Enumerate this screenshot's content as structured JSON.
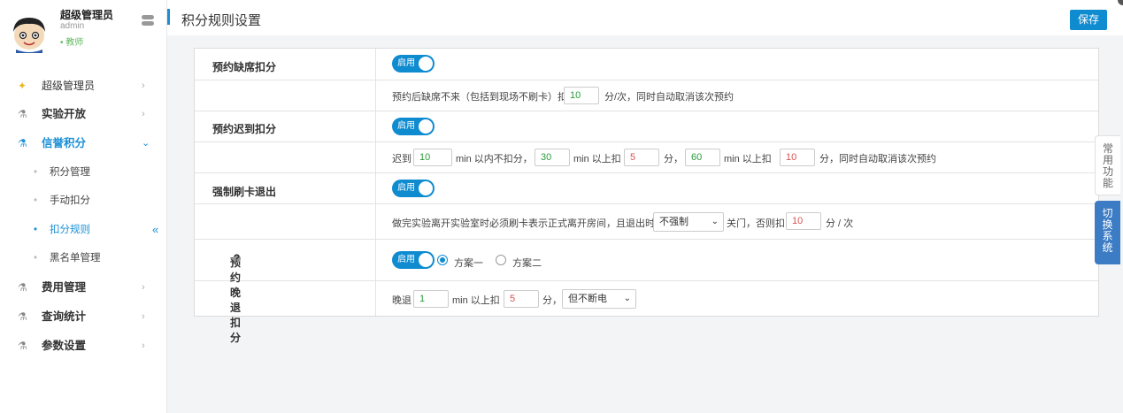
{
  "profile": {
    "name": "超级管理员",
    "account": "admin",
    "role": "• 教师"
  },
  "sidebar": {
    "items": [
      {
        "label": "超级管理员",
        "chevron": "›"
      },
      {
        "label": "实验开放",
        "chevron": "›"
      },
      {
        "label": "信誉积分",
        "chevron": "⌄"
      },
      {
        "label": "费用管理",
        "chevron": "›"
      },
      {
        "label": "查询统计",
        "chevron": "›"
      },
      {
        "label": "参数设置",
        "chevron": "›"
      }
    ],
    "sub_items": [
      {
        "label": "积分管理"
      },
      {
        "label": "手动扣分"
      },
      {
        "label": "扣分规则"
      },
      {
        "label": "黑名单管理"
      }
    ],
    "collapse_glyph": "«"
  },
  "header": {
    "title": "积分规则设置",
    "save_label": "保存"
  },
  "switch_label": "启用",
  "rules": {
    "absence": {
      "label": "预约缺席扣分",
      "text_a": "预约后缺席不来（包括到现场不刷卡）扣",
      "points": "10",
      "text_b": "分/次，同时自动取消该次预约"
    },
    "late": {
      "label": "预约迟到扣分",
      "t1": "迟到",
      "v1": "10",
      "t2": "min 以内不扣分，",
      "v2": "30",
      "t3": "min 以上扣",
      "v3": "5",
      "t4": "分，",
      "v4": "60",
      "t5": "min 以上扣",
      "v5": "10",
      "t6": "分，同时自动取消该次预约"
    },
    "forced_card": {
      "label": "强制刷卡退出",
      "text_a": "做完实验离开实验室时必须刷卡表示正式离开房间，且退出时",
      "select_value": "不强制",
      "text_b": "关门，否则扣",
      "points": "10",
      "text_c": "分 / 次"
    },
    "early_leave": {
      "label": "预约晚退扣分",
      "help": "?",
      "option1": "方案一",
      "option2": "方案二",
      "t1": "晚退",
      "v1": "1",
      "t2": "min 以上扣",
      "v2": "5",
      "t3": "分，",
      "select_value": "但不断电"
    }
  },
  "side_tabs": {
    "common": "常用功能",
    "switch": "切换系统"
  },
  "colors": {
    "accent": "#0f8bd0",
    "active_menu": "#1a8fd6",
    "green_value": "#2a9a3a",
    "red_value": "#d9534f"
  }
}
